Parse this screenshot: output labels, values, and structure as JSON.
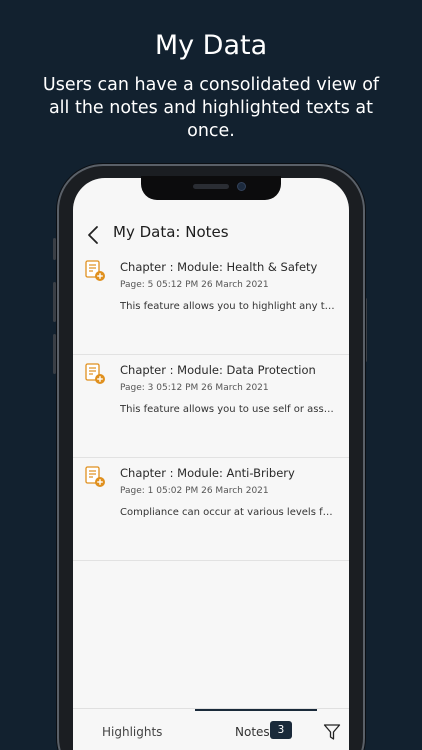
{
  "promo": {
    "title": "My Data",
    "subtitle": "Users can have a consolidated view of all the notes and highlighted texts at once."
  },
  "screen": {
    "title": "My Data: Notes",
    "notes": [
      {
        "title": "Chapter : Module: Health & Safety",
        "meta": "Page: 5  05:12 PM 26 March 2021",
        "text": "This feature allows you to highlight any ter..."
      },
      {
        "title": "Chapter : Module: Data Protection",
        "meta": "Page: 3  05:12 PM 26 March 2021",
        "text": "This feature allows you to use self or assign..."
      },
      {
        "title": "Chapter : Module: Anti-Bribery",
        "meta": "Page: 1  05:02 PM 26 March 2021",
        "text": "Compliance can occur at various levels fro..."
      }
    ],
    "tabs": {
      "highlights_label": "Highlights",
      "notes_label": "Notes",
      "notes_count": "3"
    }
  },
  "colors": {
    "background": "#12212f",
    "accent_icon": "#e0901e",
    "badge": "#1a2a3a"
  },
  "icons": {
    "back": "chevron-left-icon",
    "note": "note-add-icon",
    "filter": "filter-icon"
  }
}
